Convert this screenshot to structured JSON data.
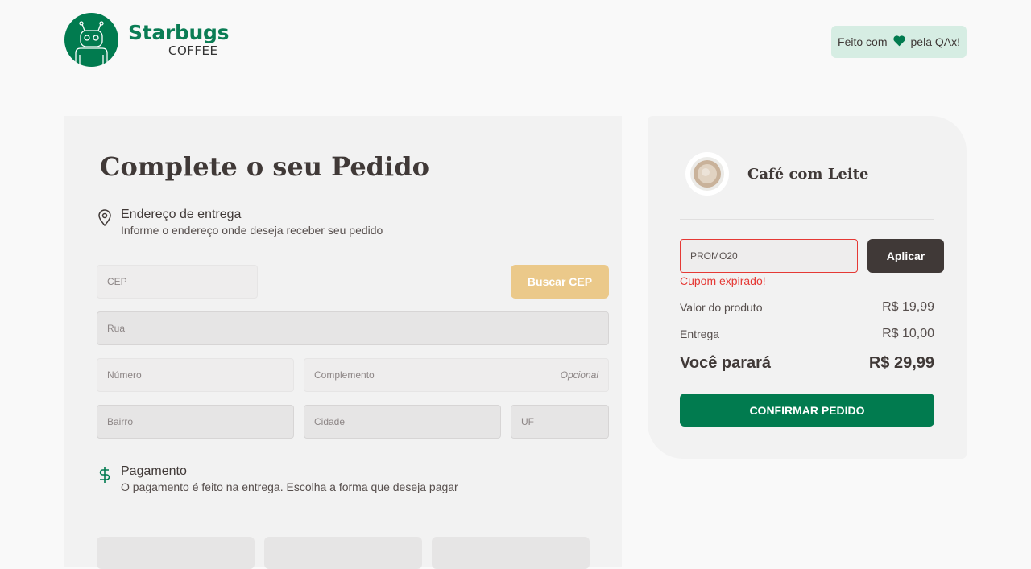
{
  "header": {
    "logo_title": "Starbugs",
    "logo_subtitle": "COFFEE",
    "made_with_prefix": "Feito com",
    "made_with_suffix": "pela QAx!"
  },
  "checkout": {
    "title": "Complete o seu Pedido",
    "address": {
      "title": "Endereço de entrega",
      "subtitle": "Informe o endereço onde deseja receber seu pedido",
      "cep_placeholder": "CEP",
      "search_cep_label": "Buscar CEP",
      "street_placeholder": "Rua",
      "number_placeholder": "Número",
      "complement_placeholder": "Complemento",
      "complement_optional": "Opcional",
      "district_placeholder": "Bairro",
      "city_placeholder": "Cidade",
      "uf_placeholder": "UF"
    },
    "payment": {
      "title": "Pagamento",
      "subtitle": "O pagamento é feito na entrega. Escolha a forma que deseja pagar"
    }
  },
  "summary": {
    "product_name": "Café com Leite",
    "coupon_value": "PROMO20",
    "apply_label": "Aplicar",
    "coupon_error": "Cupom expirado!",
    "product_value_label": "Valor do produto",
    "product_value": "R$ 19,99",
    "delivery_label": "Entrega",
    "delivery_value": "R$ 10,00",
    "total_label": "Você parará",
    "total_value": "R$ 29,99",
    "confirm_label": "CONFIRMAR PEDIDO"
  },
  "colors": {
    "brand_green": "#017b4f",
    "dark_button": "#403937",
    "error_red": "#e53935",
    "cep_button": "#ebc98a"
  }
}
